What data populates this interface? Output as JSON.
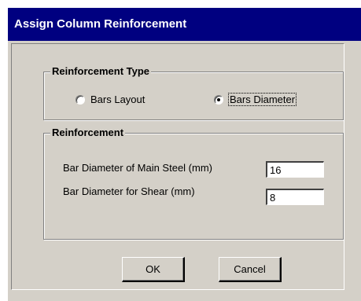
{
  "window": {
    "title": "Assign Column Reinforcement"
  },
  "reinforcement_type": {
    "title": "Reinforcement Type",
    "options": [
      {
        "label": "Bars Layout",
        "selected": false
      },
      {
        "label": "Bars Diameter",
        "selected": true
      }
    ]
  },
  "reinforcement": {
    "title": "Reinforcement",
    "main_steel": {
      "label": "Bar Diameter of Main Steel (mm)",
      "value": "16"
    },
    "shear": {
      "label": "Bar Diameter for Shear (mm)",
      "value": "8"
    }
  },
  "buttons": {
    "ok": "OK",
    "cancel": "Cancel"
  },
  "colors": {
    "titlebar": "#000080",
    "face": "#d4d0c8"
  }
}
